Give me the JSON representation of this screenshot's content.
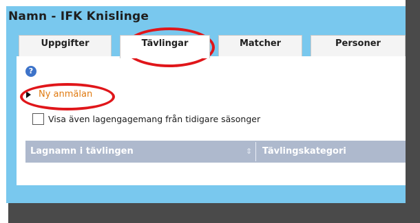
{
  "window": {
    "title": "Namn - IFK Knislinge"
  },
  "tabs": [
    {
      "label": "Uppgifter",
      "active": false
    },
    {
      "label": "Tävlingar",
      "active": true
    },
    {
      "label": "Matcher",
      "active": false
    },
    {
      "label": "Personer",
      "active": false
    }
  ],
  "help": {
    "icon": "help-icon",
    "glyph": "?"
  },
  "actions": {
    "new_registration": "Ny anmälan",
    "bullet_icon": "triangle-bullet-icon"
  },
  "options": {
    "show_previous_label": "Visa även lagengagemang från tidigare säsonger",
    "show_previous_checked": false
  },
  "grid": {
    "columns": [
      "Lagnamn i tävlingen",
      "Tävlingskategori"
    ],
    "sort_icon": "sort-icon",
    "sort_glyph": "⇕",
    "rows": []
  },
  "colors": {
    "window_bg": "#79c8ee",
    "grid_header_bg": "#aeb9cd",
    "link": "#e07a10",
    "highlight": "#e0161a"
  }
}
